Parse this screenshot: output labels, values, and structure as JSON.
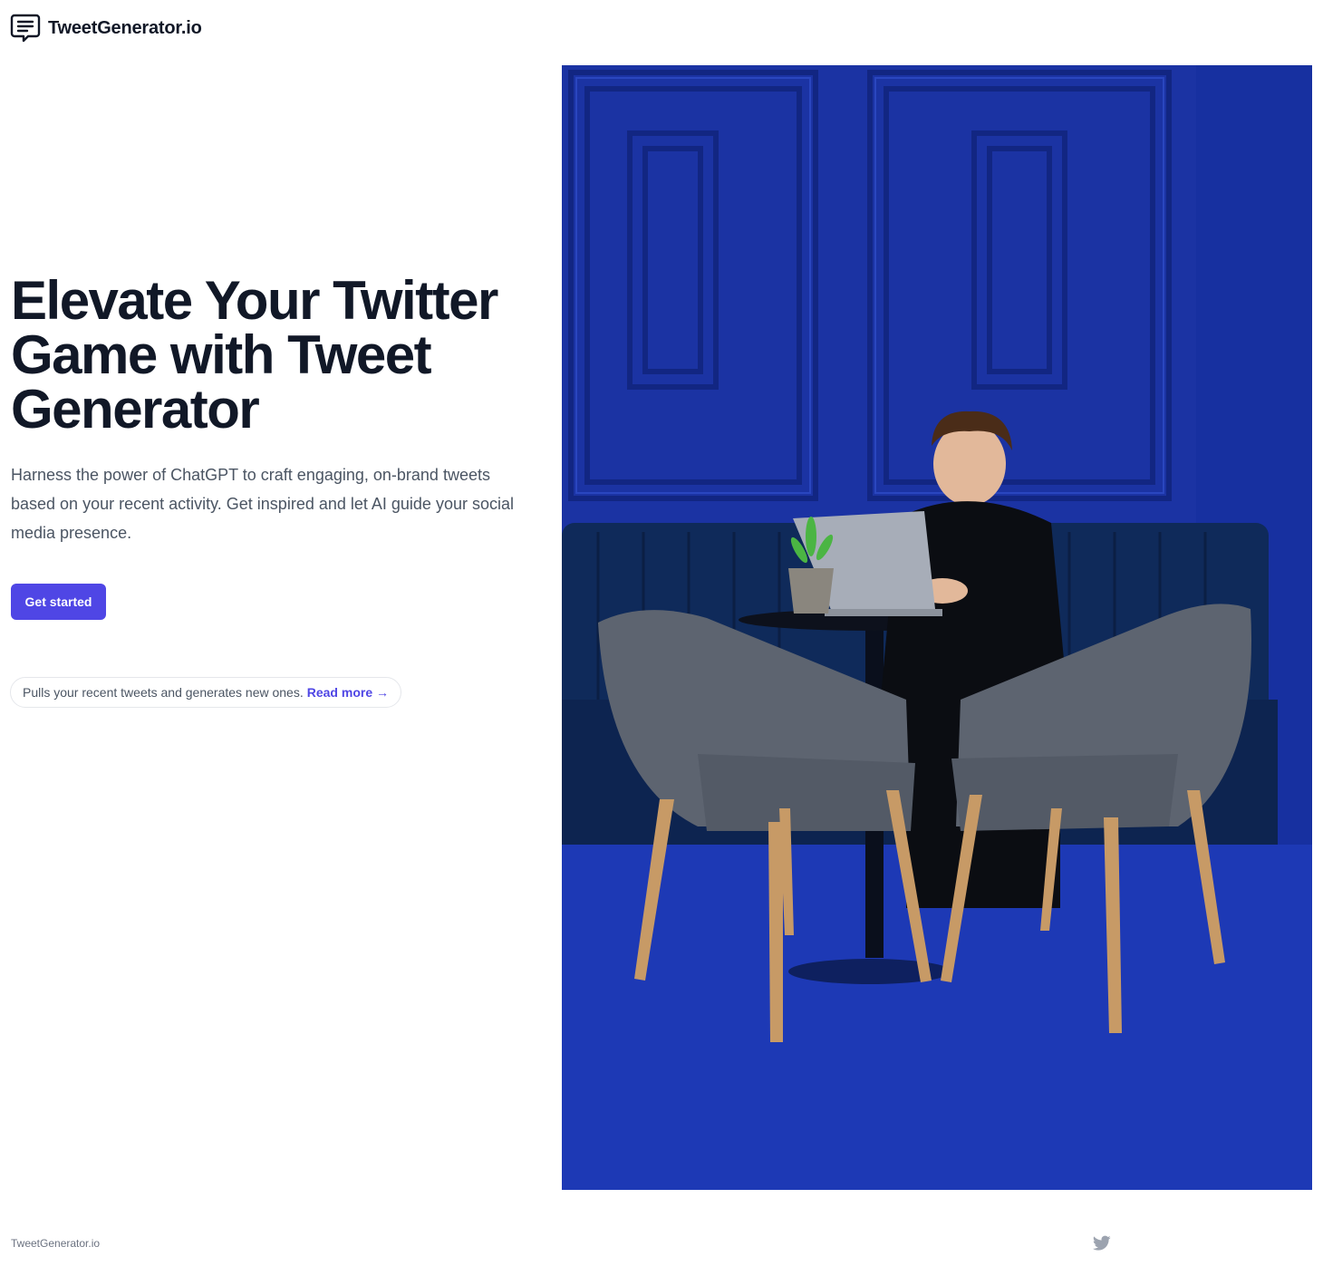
{
  "header": {
    "brand_name": "TweetGenerator.io",
    "icon": "chat-bubble-icon"
  },
  "hero": {
    "title": "Elevate Your Twitter Game with Tweet Generator",
    "subtitle": "Harness the power of ChatGPT to craft engaging, on-brand tweets based on your recent activity. Get inspired and let AI guide your social media presence.",
    "cta_label": "Get started",
    "pill_text": "Pulls your recent tweets and generates new ones.",
    "pill_link_label": "Read more",
    "pill_link_arrow": "→",
    "image": "man-working-on-laptop-in-blue-room-photo"
  },
  "footer": {
    "brand_name": "TweetGenerator.io",
    "social_icon": "twitter-icon"
  },
  "colors": {
    "accent": "#4f46e5",
    "heading": "#111827",
    "body_text": "#4b5563",
    "photo_wall": "#1a34a8"
  }
}
